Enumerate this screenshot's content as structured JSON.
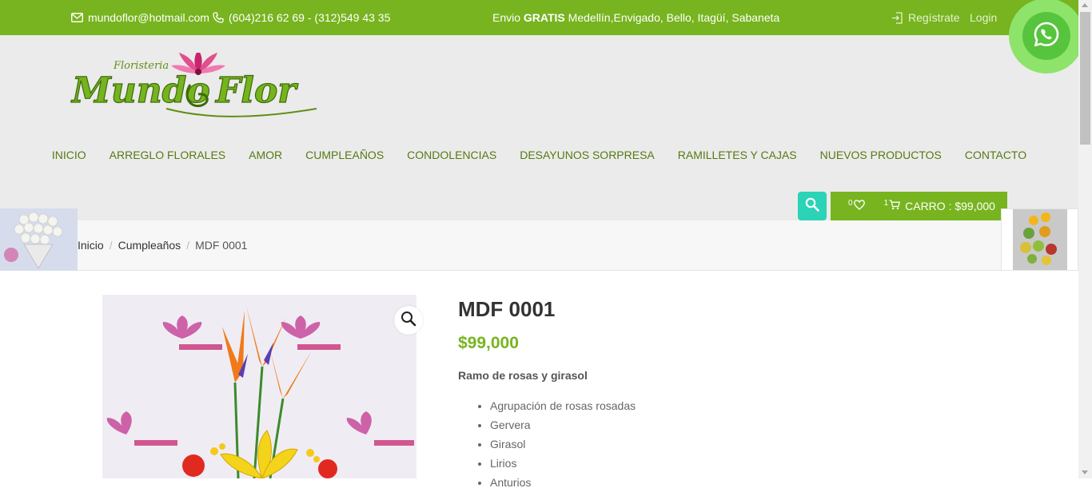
{
  "topbar": {
    "email": "mundoflor@hotmail.com",
    "phone": "(604)216 62 69 - (312)549 43 35",
    "shipping_prefix": "Envio ",
    "shipping_bold": "GRATIS",
    "shipping_rest": " Medellín,Envigado, Bello, Itagüí, Sabaneta",
    "register": "Regístrate",
    "login": "Login"
  },
  "logo": {
    "small": "Floristeria",
    "main": "Mundo",
    "main2": "Flor"
  },
  "nav": [
    "INICIO",
    "ARREGLO FLORALES",
    "AMOR",
    "CUMPLEAÑOS",
    "CONDOLENCIAS",
    "DESAYUNOS SORPRESA",
    "RAMILLETES Y CAJAS",
    "NUEVOS PRODUCTOS",
    "CONTACTO"
  ],
  "cart": {
    "wishlist_count": "0",
    "cart_count": "1",
    "label": "CARRO : $99,000"
  },
  "breadcrumb": {
    "home": "Inicio",
    "category": "Cumpleaños",
    "current": "MDF 0001"
  },
  "product": {
    "title": "MDF 0001",
    "price": "$99,000",
    "subtitle": "Ramo de rosas y girasol",
    "items": [
      "Agrupación de rosas rosadas",
      "Gervera",
      "Girasol",
      "Lirios",
      "Anturios"
    ]
  },
  "colors": {
    "brand_green": "#77b41f",
    "nav_green": "#557a12",
    "search_teal": "#2bd3b7",
    "whatsapp": "#57c43d"
  },
  "icons": {
    "email": "envelope-icon",
    "phone": "phone-icon",
    "register": "login-arrow-icon",
    "search": "search-icon",
    "wishlist": "heart-icon",
    "cart": "cart-icon",
    "zoom": "magnifier-icon",
    "whatsapp": "whatsapp-icon"
  }
}
